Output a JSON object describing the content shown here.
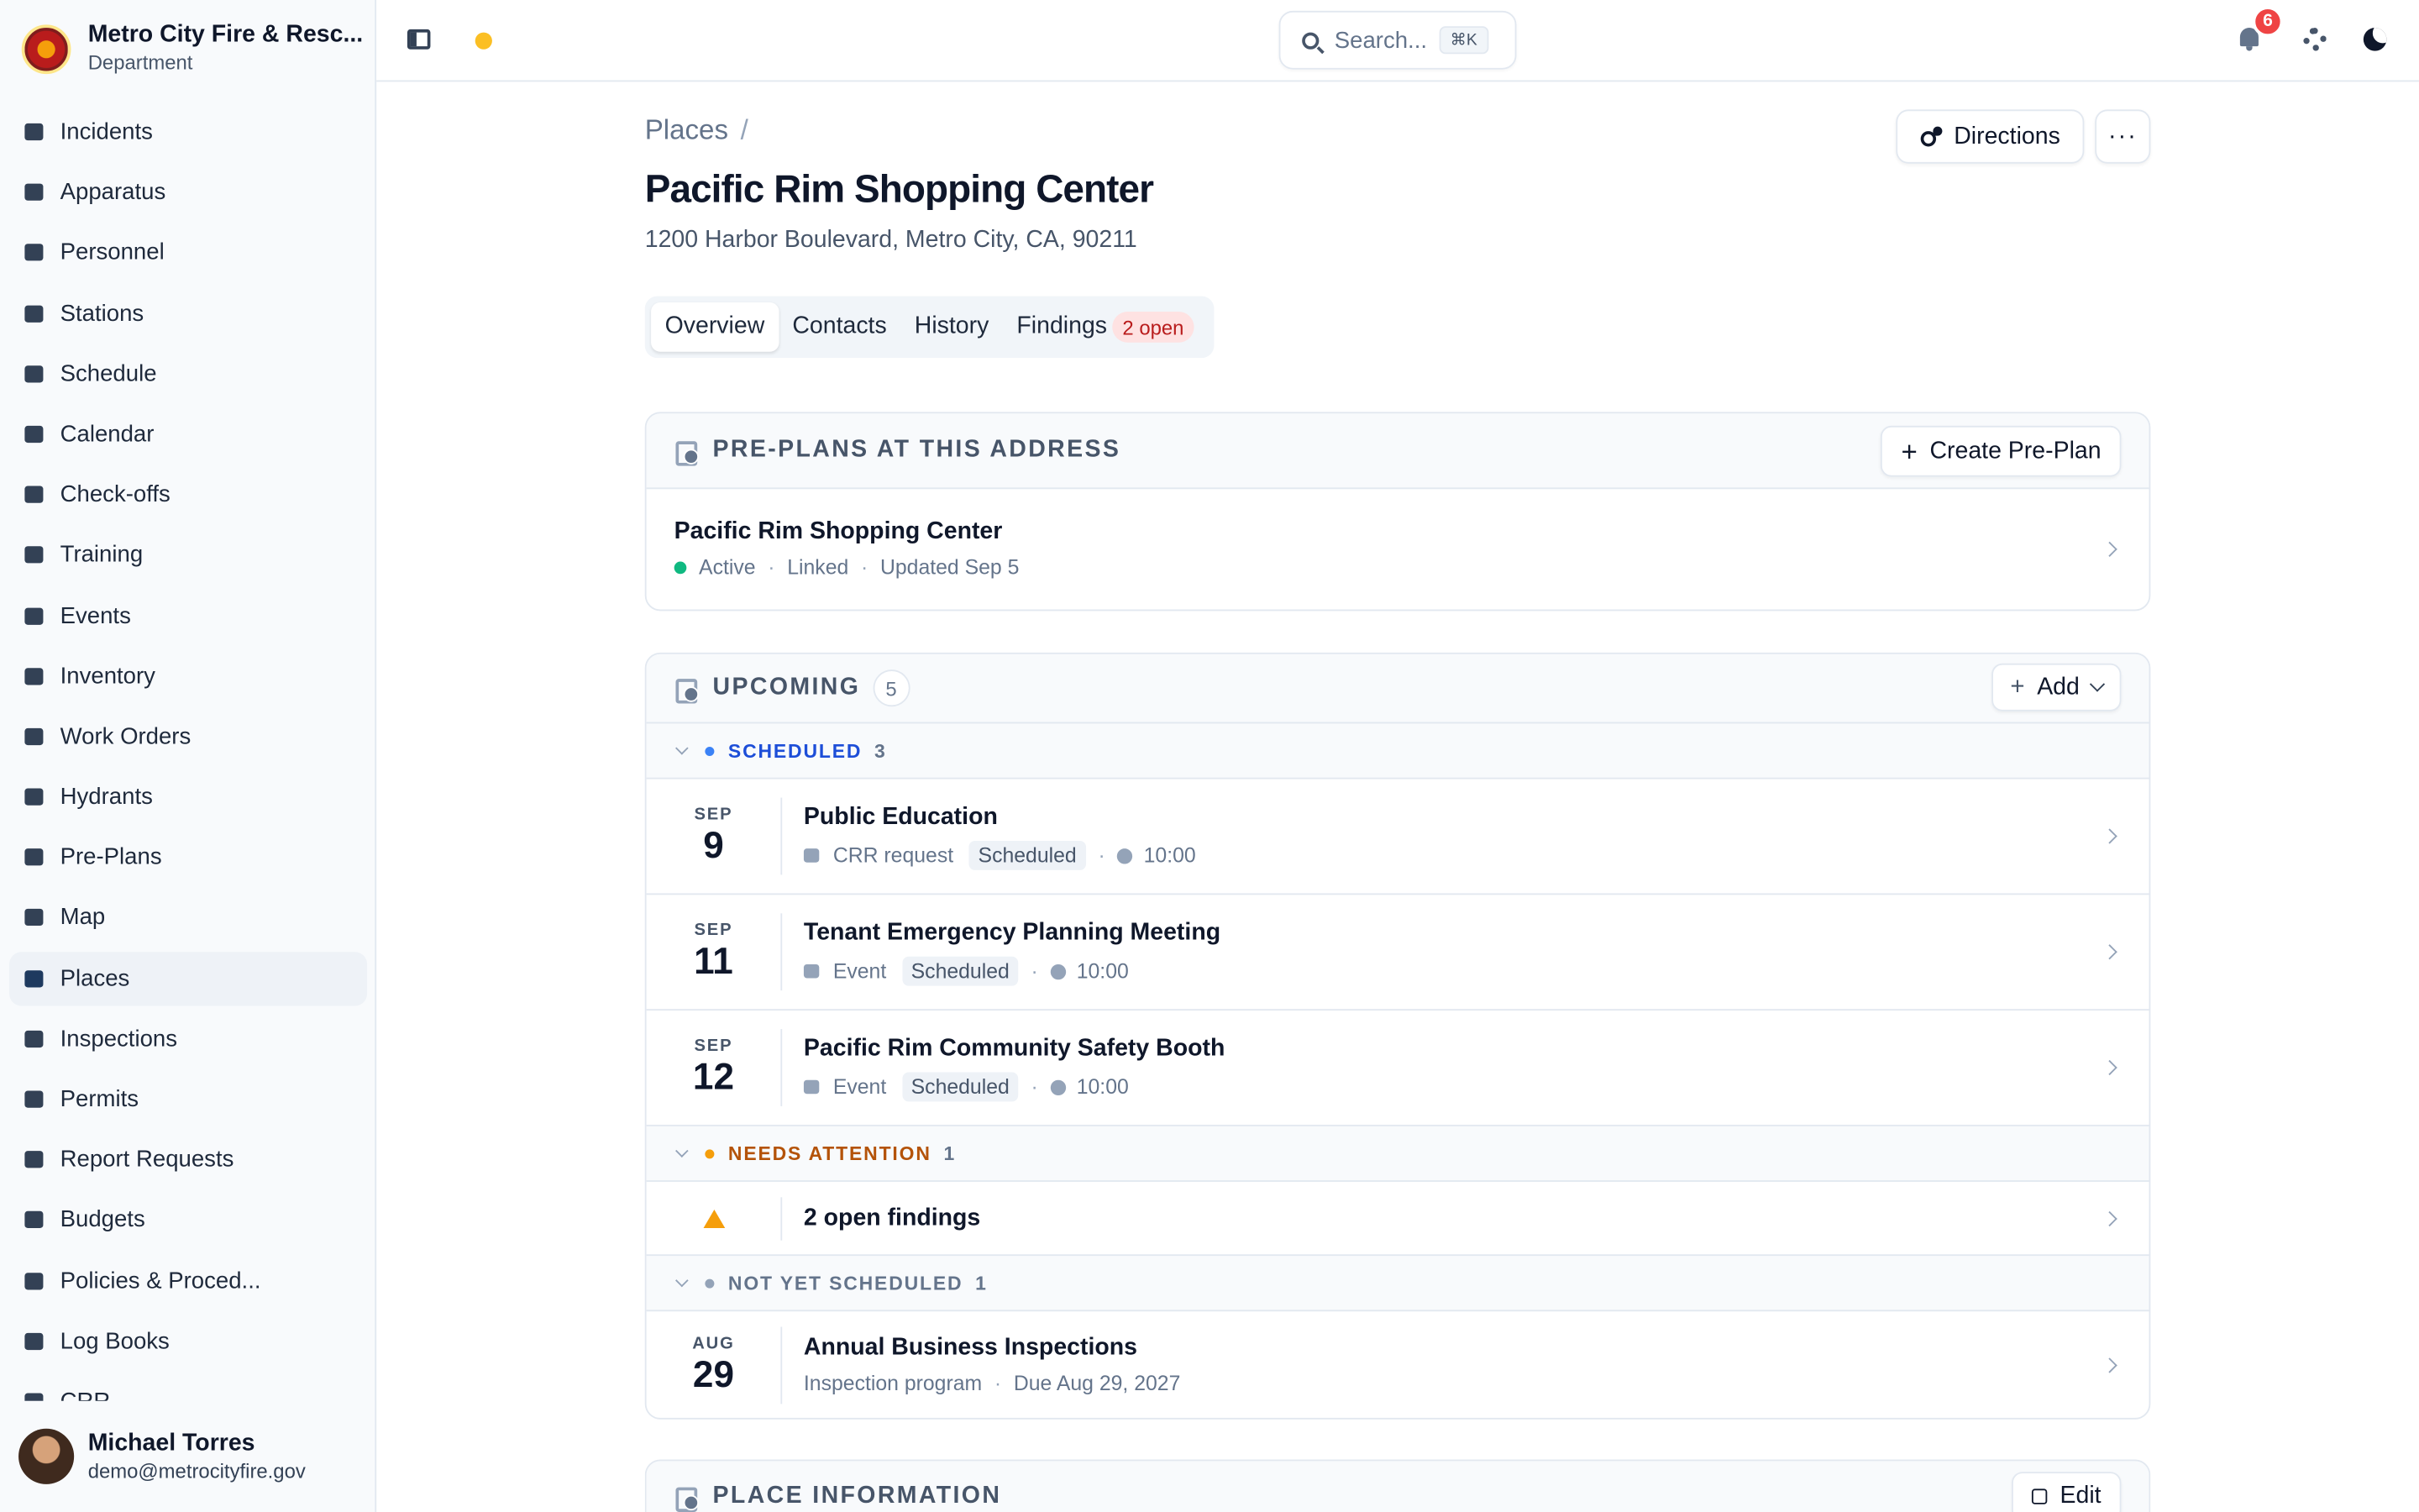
{
  "org": {
    "name": "Metro City Fire & Resc...",
    "subtitle": "Department"
  },
  "nav": [
    {
      "label": "Incidents",
      "icon": "incidents-icon"
    },
    {
      "label": "Apparatus",
      "icon": "truck-icon"
    },
    {
      "label": "Personnel",
      "icon": "id-card-icon"
    },
    {
      "label": "Stations",
      "icon": "building-icon"
    },
    {
      "label": "Schedule",
      "icon": "calendar-grid-icon"
    },
    {
      "label": "Calendar",
      "icon": "calendar-icon"
    },
    {
      "label": "Check-offs",
      "icon": "clipboard-check-icon"
    },
    {
      "label": "Training",
      "icon": "graduation-cap-icon"
    },
    {
      "label": "Events",
      "icon": "calendar-star-icon"
    },
    {
      "label": "Inventory",
      "icon": "hammer-icon"
    },
    {
      "label": "Work Orders",
      "icon": "wrench-icon"
    },
    {
      "label": "Hydrants",
      "icon": "hydrant-icon"
    },
    {
      "label": "Pre-Plans",
      "icon": "building-shield-icon"
    },
    {
      "label": "Map",
      "icon": "map-icon"
    },
    {
      "label": "Places",
      "icon": "places-icon",
      "active": true
    },
    {
      "label": "Inspections",
      "icon": "clipboard-list-icon"
    },
    {
      "label": "Permits",
      "icon": "permit-icon"
    },
    {
      "label": "Report Requests",
      "icon": "report-icon"
    },
    {
      "label": "Budgets",
      "icon": "piggy-bank-icon"
    },
    {
      "label": "Policies & Proced...",
      "icon": "book-icon"
    },
    {
      "label": "Log Books",
      "icon": "books-icon"
    },
    {
      "label": "CRR",
      "icon": "crr-icon"
    }
  ],
  "user": {
    "name": "Michael Torres",
    "email": "demo@metrocityfire.gov"
  },
  "topbar": {
    "search_placeholder": "Search...",
    "shortcut": "⌘K",
    "notification_count": "6"
  },
  "page": {
    "breadcrumb": "Places",
    "breadcrumb_sep": "/",
    "title": "Pacific Rim Shopping Center",
    "address": "1200 Harbor Boulevard, Metro City, CA, 90211",
    "directions_label": "Directions",
    "more_label": "···"
  },
  "tabs": [
    {
      "label": "Overview",
      "active": true
    },
    {
      "label": "Contacts"
    },
    {
      "label": "History"
    },
    {
      "label": "Findings",
      "badge": "2 open"
    }
  ],
  "preplans": {
    "title": "PRE-PLANS AT THIS ADDRESS",
    "create_label": "Create Pre-Plan",
    "plus": "+",
    "item": {
      "name": "Pacific Rim Shopping Center",
      "status": "Active",
      "linked": "Linked",
      "updated": "Updated Sep 5",
      "sep": "·"
    }
  },
  "upcoming": {
    "title": "UPCOMING",
    "count": "5",
    "add_label": "Add",
    "plus": "+",
    "sep": "·",
    "groups": {
      "scheduled": {
        "label": "SCHEDULED",
        "count": "3",
        "color": "#1d4ed8",
        "dot": "#3b82f6"
      },
      "attention": {
        "label": "NEEDS ATTENTION",
        "count": "1",
        "color": "#b45309",
        "dot": "#f59e0b"
      },
      "unscheduled": {
        "label": "NOT YET SCHEDULED",
        "count": "1",
        "color": "#64748b",
        "dot": "#94a3b8"
      }
    },
    "events": [
      {
        "month": "SEP",
        "day": "9",
        "title": "Public Education",
        "type": "CRR request",
        "status": "Scheduled",
        "time": "10:00"
      },
      {
        "month": "SEP",
        "day": "11",
        "title": "Tenant Emergency Planning Meeting",
        "type": "Event",
        "status": "Scheduled",
        "time": "10:00"
      },
      {
        "month": "SEP",
        "day": "12",
        "title": "Pacific Rim Community Safety Booth",
        "type": "Event",
        "status": "Scheduled",
        "time": "10:00"
      }
    ],
    "attention_item": {
      "title": "2 open findings"
    },
    "unscheduled_item": {
      "month": "AUG",
      "day": "29",
      "title": "Annual Business Inspections",
      "type": "Inspection program",
      "due": "Due Aug 29, 2027"
    }
  },
  "place_info": {
    "title": "PLACE INFORMATION",
    "edit_label": "Edit"
  }
}
